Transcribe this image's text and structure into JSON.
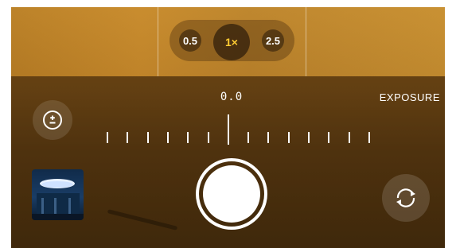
{
  "zoom": {
    "options": [
      {
        "label": "0.5",
        "active": false
      },
      {
        "label": "1×",
        "active": true
      },
      {
        "label": "2.5",
        "active": false
      }
    ]
  },
  "exposure": {
    "label": "EXPOSURE",
    "value": "0.0",
    "button_icon": "plus-minus-circle-icon"
  },
  "controls": {
    "thumbnail_icon": "last-photo-thumbnail",
    "shutter_icon": "shutter",
    "flip_icon": "camera-flip-icon"
  },
  "colors": {
    "active_zoom": "#ffcc33",
    "tick": "#ffffff"
  }
}
